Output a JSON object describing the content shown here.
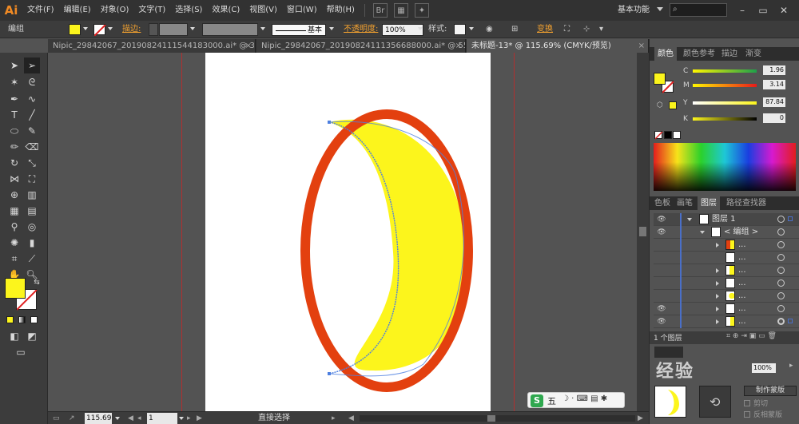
{
  "app": {
    "logo": "Ai"
  },
  "menu": [
    "文件(F)",
    "编辑(E)",
    "对象(O)",
    "文字(T)",
    "选择(S)",
    "效果(C)",
    "视图(V)",
    "窗口(W)",
    "帮助(H)"
  ],
  "workspace": "基本功能",
  "control": {
    "selection_label": "编组",
    "stroke_label": "描边:",
    "brush_label": "基本",
    "opacity_label": "不透明度:",
    "opacity_value": "100%",
    "style_label": "样式:",
    "transform_label": "变换",
    "fill_color": "#fcf51c"
  },
  "tabs": [
    {
      "label": "Nipic_29842067_20190824111544183000.ai* @ 38...",
      "close": "×"
    },
    {
      "label": "Nipic_29842067_20190824111356688000.ai* @ 55...",
      "close": "×"
    },
    {
      "label": "未标题-13* @ 115.69% (CMYK/预览)",
      "close": "×"
    }
  ],
  "status": {
    "zoom": "115.69",
    "page": "1",
    "tool_name": "直接选择"
  },
  "color_panel": {
    "tabs": [
      "颜色",
      "颜色参考",
      "描边",
      "渐变"
    ],
    "channels": [
      {
        "name": "C",
        "value": "1.96",
        "level": 0.02
      },
      {
        "name": "M",
        "value": "3.14",
        "level": 0.03
      },
      {
        "name": "Y",
        "value": "87.84",
        "level": 0.88
      },
      {
        "name": "K",
        "value": "0",
        "level": 0.0
      }
    ],
    "fill": "#fcf51c"
  },
  "layers_panel": {
    "tabs": [
      "色板",
      "画笔",
      "图层",
      "路径查找器"
    ],
    "layer_name": "图层 1",
    "group_name": "< 编组 >",
    "sub_dots": "...",
    "count": "1 个图层"
  },
  "transparency": {
    "value": "100%",
    "make_mask": "制作蒙版",
    "clip": "剪切",
    "invert": "反相蒙版"
  },
  "watermark": "经验",
  "ime": "五",
  "icons": [
    "selection-icon",
    "direct-selection-icon",
    "pen-icon",
    "type-icon",
    "eye-icon"
  ]
}
